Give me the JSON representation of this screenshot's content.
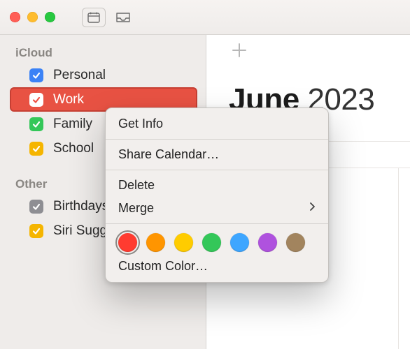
{
  "titlebar": {
    "buttons": {
      "calendar": "calendar-icon",
      "inbox": "tray-icon"
    }
  },
  "sidebar": {
    "sections": [
      {
        "name": "iCloud",
        "items": [
          {
            "label": "Personal",
            "color": "#3b82f6",
            "checked": true,
            "selected": false
          },
          {
            "label": "Work",
            "color": "#ef5043",
            "checked": true,
            "selected": true
          },
          {
            "label": "Family",
            "color": "#34c759",
            "checked": true,
            "selected": false
          },
          {
            "label": "School",
            "color": "#f5b500",
            "checked": true,
            "selected": false
          }
        ]
      },
      {
        "name": "Other",
        "items": [
          {
            "label": "Birthdays",
            "color": "#8e8e93",
            "checked": true,
            "selected": false
          },
          {
            "label": "Siri Suggestions",
            "color": "#f5b500",
            "checked": true,
            "selected": false
          }
        ]
      }
    ]
  },
  "content": {
    "month": "June",
    "year": "2023"
  },
  "context_menu": {
    "get_info": "Get Info",
    "share": "Share Calendar…",
    "delete": "Delete",
    "merge": "Merge",
    "custom_color": "Custom Color…",
    "swatches": [
      {
        "color": "#ff3b30",
        "selected": true
      },
      {
        "color": "#ff9500",
        "selected": false
      },
      {
        "color": "#ffcc00",
        "selected": false
      },
      {
        "color": "#34c759",
        "selected": false
      },
      {
        "color": "#3ea6ff",
        "selected": false
      },
      {
        "color": "#af52de",
        "selected": false
      },
      {
        "color": "#a2845e",
        "selected": false
      }
    ]
  }
}
